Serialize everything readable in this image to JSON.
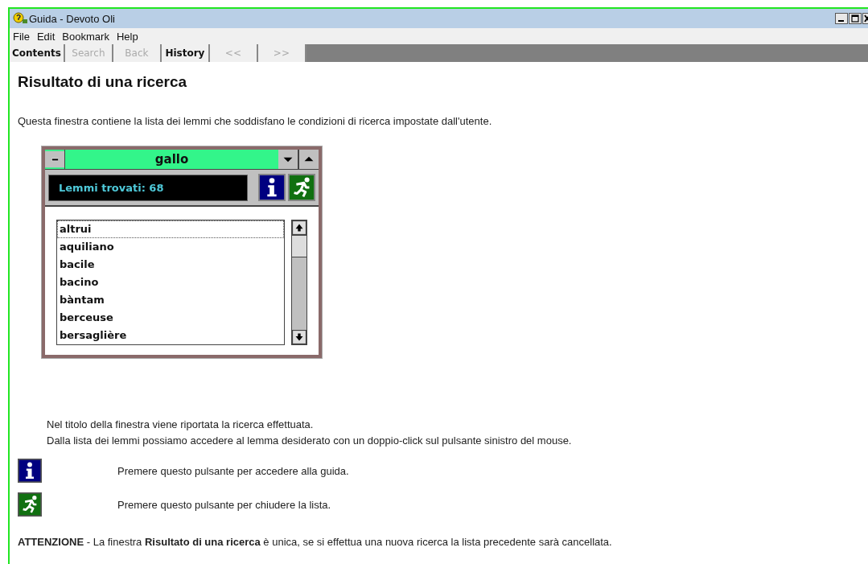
{
  "window": {
    "title": "Guida - Devoto Oli"
  },
  "menu": [
    "File",
    "Edit",
    "Bookmark",
    "Help"
  ],
  "toolbar": [
    {
      "label": "Contents",
      "disabled": false
    },
    {
      "label": "Search",
      "disabled": true
    },
    {
      "label": "Back",
      "disabled": true
    },
    {
      "label": "History",
      "disabled": false
    },
    {
      "label": "<<",
      "disabled": true
    },
    {
      "label": ">>",
      "disabled": true
    }
  ],
  "heading": "Risultato di una ricerca",
  "intro": "Questa finestra contiene la lista dei lemmi che soddisfano le condizioni di ricerca impostate dall'utente.",
  "result_window": {
    "title": "gallo",
    "count": "Lemmi trovati: 68",
    "items": [
      {
        "label": "altrui",
        "selected": true
      },
      {
        "label": "aquiliano",
        "selected": false
      },
      {
        "label": "bacile",
        "selected": false
      },
      {
        "label": "bacino",
        "selected": false
      },
      {
        "label": "bàntam",
        "selected": false
      },
      {
        "label": "berceuse",
        "selected": false
      },
      {
        "label": "bersaglière",
        "selected": false
      }
    ]
  },
  "notes": [
    "Nel titolo della finestra viene riportata la ricerca effettuata.",
    "Dalla lista dei lemmi possiamo accedere al lemma desiderato con un doppio-click sul pulsante sinistro del mouse."
  ],
  "buttons_help": [
    {
      "kind": "info",
      "text": "Premere questo pulsante per accedere alla guida."
    },
    {
      "kind": "exit",
      "text": "Premere questo pulsante per chiudere la lista."
    }
  ],
  "warning": "**ATTENZIONE** - La finestra **Risultato di una ricerca** è unica, se si effettua una nuova ricerca la lista precedente sarà cancellata."
}
